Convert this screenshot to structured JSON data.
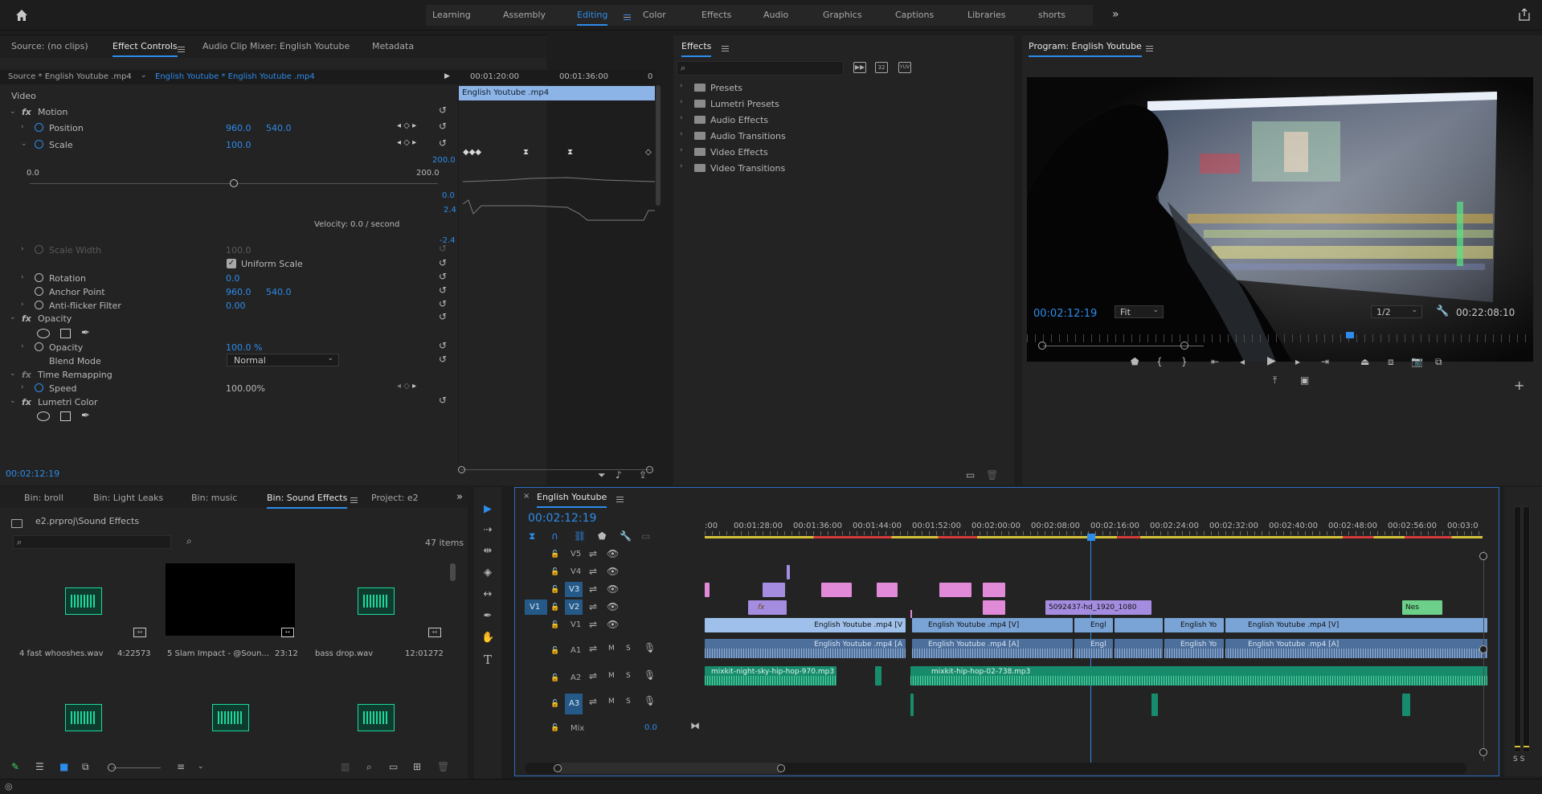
{
  "workspaces": [
    "Learning",
    "Assembly",
    "Editing",
    "Color",
    "Effects",
    "Audio",
    "Graphics",
    "Captions",
    "Libraries",
    "shorts"
  ],
  "active_workspace": "Editing",
  "effect_panel": {
    "tabs": [
      "Source: (no clips)",
      "Effect Controls",
      "Audio Clip Mixer: English Youtube",
      "Metadata"
    ],
    "source_label": "Source * English Youtube .mp4",
    "sequence_label": "English Youtube * English Youtube .mp4",
    "ruler_times": [
      "00:01:20:00",
      "00:01:36:00",
      "0"
    ],
    "clip_bar": "English Youtube .mp4",
    "section_video": "Video",
    "motion": "Motion",
    "position_label": "Position",
    "position_x": "960.0",
    "position_y": "540.0",
    "scale_label": "Scale",
    "scale_value": "100.0",
    "scale_max": "200.0",
    "slider_min": "0.0",
    "slider_max": "200.0",
    "graph_zero": "0.0",
    "graph_top": "2.4",
    "graph_bottom": "-2.4",
    "velocity": "Velocity: 0.0 / second",
    "scale_width_label": "Scale Width",
    "scale_width_value": "100.0",
    "uniform_scale": "Uniform Scale",
    "rotation_label": "Rotation",
    "rotation_value": "0.0",
    "anchor_label": "Anchor Point",
    "anchor_x": "960.0",
    "anchor_y": "540.0",
    "antiflicker_label": "Anti-flicker Filter",
    "antiflicker_value": "0.00",
    "opacity_section": "Opacity",
    "opacity_label": "Opacity",
    "opacity_value": "100.0 %",
    "blend_label": "Blend Mode",
    "blend_value": "Normal",
    "time_remap": "Time Remapping",
    "speed_label": "Speed",
    "speed_value": "100.00%",
    "lumetri": "Lumetri Color",
    "timecode": "00:02:12:19"
  },
  "effects_panel": {
    "title": "Effects",
    "folders": [
      "Presets",
      "Lumetri Presets",
      "Audio Effects",
      "Audio Transitions",
      "Video Effects",
      "Video Transitions"
    ],
    "toolbar_icons": [
      "32",
      "YUV"
    ]
  },
  "program": {
    "title": "Program: English Youtube",
    "timecode": "00:02:12:19",
    "fit": "Fit",
    "resolution": "1/2",
    "duration": "00:22:08:10"
  },
  "bin": {
    "tabs": [
      "Bin: broll",
      "Bin: Light Leaks",
      "Bin: music",
      "Bin: Sound Effects",
      "Project: e2"
    ],
    "active_tab": "Bin: Sound Effects",
    "path": "e2.prproj\\Sound Effects",
    "count": "47 items",
    "items": [
      {
        "name": "4 fast whooshes.wav",
        "duration": "4:22573"
      },
      {
        "name": "5 Slam Impact - @Soun...",
        "duration": "23:12"
      },
      {
        "name": "bass drop.wav",
        "duration": "12:01272"
      }
    ]
  },
  "timeline": {
    "title": "English Youtube",
    "timecode": "00:02:12:19",
    "ruler": [
      "00:01:20:00",
      "00:01:28:00",
      "00:01:36:00",
      "00:01:44:00",
      "00:01:52:00",
      "00:02:00:00",
      "00:02:08:00",
      "00:02:16:00",
      "00:02:24:00",
      "00:02:32:00",
      "00:02:40:00",
      "00:02:48:00",
      "00:02:56:00",
      "00:03:0"
    ],
    "ruler_first": ":00",
    "tracks_video": [
      "V5",
      "V4",
      "V3",
      "V2",
      "V1"
    ],
    "tracks_audio": [
      "A1",
      "A2",
      "A3"
    ],
    "source_patch_v": "V1",
    "mix_label": "Mix",
    "mix_value": "0.0",
    "toggle_m": "M",
    "toggle_s": "S",
    "meter_label": "S S",
    "clips": {
      "v1_a": "English Youtube .mp4 [V",
      "v1_b": "English Youtube .mp4 [V]",
      "v1_c": "Engl",
      "v1_d": "English Yo",
      "v1_e": "English Youtube .mp4 [V]",
      "v2_a": "5092437-hd_1920_1080",
      "v2_b": "Nes",
      "a1_a": "English Youtube .mp4 [A",
      "a1_b": "English Youtube .mp4 [A]",
      "a1_c": "Engl",
      "a1_d": "English Yo",
      "a1_e": "English Youtube .mp4 [A]",
      "a2_a": "mixkit-night-sky-hip-hop-970.mp3",
      "a2_b": "mixkit-hip-hop-02-738.mp3"
    },
    "fx_badge": "fx"
  }
}
